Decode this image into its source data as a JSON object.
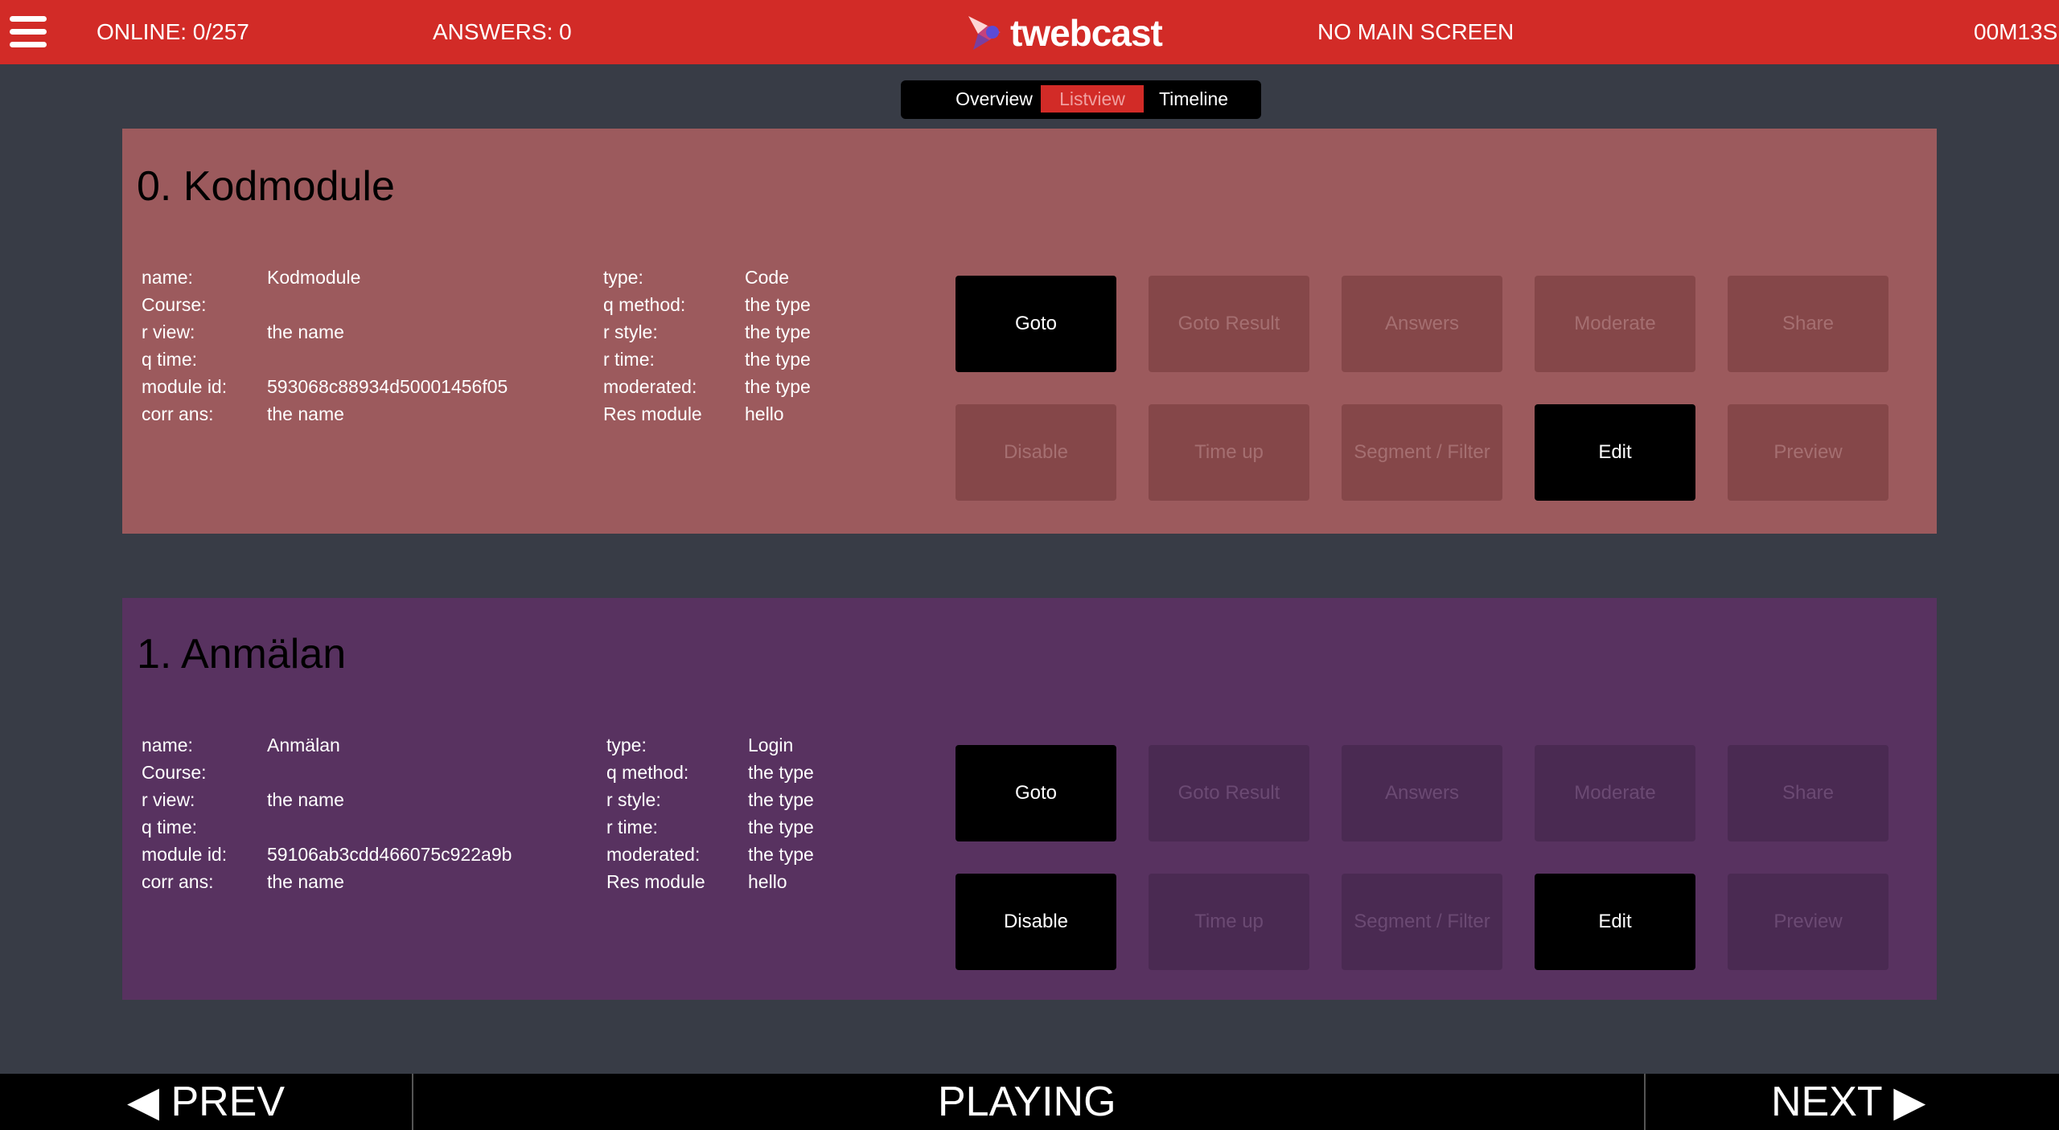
{
  "header": {
    "menu_icon": "hamburger-icon",
    "online": "ONLINE: 0/257",
    "answers": "ANSWERS: 0",
    "brand": "twebcast",
    "screen": "NO MAIN SCREEN",
    "timer": "00M13S",
    "bar_color": "#d22b27"
  },
  "view_tabs": {
    "overview": "Overview",
    "listview": "Listview",
    "timeline": "Timeline",
    "active": "Listview"
  },
  "modules": [
    {
      "title": "0. Kodmodule",
      "color": "#9c5a5d",
      "left_labels": [
        "name:",
        "Course:",
        "r view:",
        "q time:",
        "module id:",
        "corr ans:"
      ],
      "left_values": [
        "Kodmodule",
        "",
        "the name",
        "",
        "593068c88934d50001456f05",
        "the name"
      ],
      "right_labels": [
        "type:",
        "q method:",
        "r style:",
        "r time:",
        "moderated:",
        "Res module"
      ],
      "right_values": [
        "Code",
        "the type",
        "the type",
        "the type",
        "the type",
        "hello"
      ],
      "buttons": [
        {
          "label": "Goto",
          "enabled": true
        },
        {
          "label": "Goto Result",
          "enabled": false
        },
        {
          "label": "Answers",
          "enabled": false
        },
        {
          "label": "Moderate",
          "enabled": false
        },
        {
          "label": "Share",
          "enabled": false
        },
        {
          "label": "Disable",
          "enabled": false
        },
        {
          "label": "Time up",
          "enabled": false
        },
        {
          "label": "Segment / Filter",
          "enabled": false
        },
        {
          "label": "Edit",
          "enabled": true
        },
        {
          "label": "Preview",
          "enabled": false
        }
      ]
    },
    {
      "title": "1. Anmälan",
      "color": "#583260",
      "left_labels": [
        "name:",
        "Course:",
        "r view:",
        "q time:",
        "module id:",
        "corr ans:"
      ],
      "left_values": [
        "Anmälan",
        "",
        "the name",
        "",
        "59106ab3cdd466075c922a9b",
        "the name"
      ],
      "right_labels": [
        "type:",
        "q method:",
        "r style:",
        "r time:",
        "moderated:",
        "Res module"
      ],
      "right_values": [
        "Login",
        "the type",
        "the type",
        "the type",
        "the type",
        "hello"
      ],
      "buttons": [
        {
          "label": "Goto",
          "enabled": true
        },
        {
          "label": "Goto Result",
          "enabled": false
        },
        {
          "label": "Answers",
          "enabled": false
        },
        {
          "label": "Moderate",
          "enabled": false
        },
        {
          "label": "Share",
          "enabled": false
        },
        {
          "label": "Disable",
          "enabled": true
        },
        {
          "label": "Time up",
          "enabled": false
        },
        {
          "label": "Segment / Filter",
          "enabled": false
        },
        {
          "label": "Edit",
          "enabled": true
        },
        {
          "label": "Preview",
          "enabled": false
        }
      ]
    }
  ],
  "footer": {
    "prev": "◀ PREV",
    "status": "PLAYING",
    "next": "NEXT ▶"
  }
}
